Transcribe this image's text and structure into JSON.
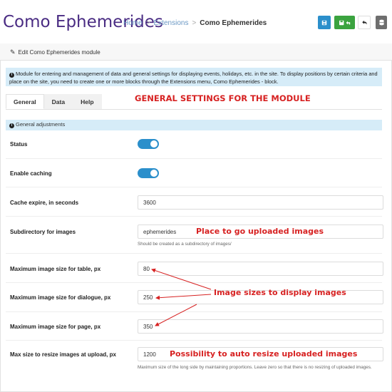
{
  "header": {
    "title": "Como Ephemerides",
    "breadcrumb": {
      "home": "Home",
      "extensions": "Extensions",
      "current": "Como Ephemerides"
    },
    "separator": ">"
  },
  "toolbar": {
    "save_icon": "save-icon",
    "save_close_icon": "save-close-icon",
    "back_icon": "undo-icon",
    "db_icon": "database-icon",
    "colors": {
      "save": "#2b8fcb",
      "save_close": "#3ba33f",
      "db": "#6e6e6e"
    }
  },
  "panel": {
    "heading": "Edit Como Ephemerides module",
    "info": "Module for entering and management of data and general settings for displaying events, holidays, etc. in the site. To display positions by certain criteria and place on the site, you need to create one or more blocks through the Extensions menu, Como Ephemerides - block.",
    "tabs": [
      "General",
      "Data",
      "Help"
    ],
    "section": "General adjustments"
  },
  "settings": {
    "status_label": "Status",
    "status_on": true,
    "caching_label": "Enable caching",
    "caching_on": true,
    "cache_expire_label": "Cache expire, in seconds",
    "cache_expire_value": "3600",
    "subdir_label": "Subdirectory for images",
    "subdir_value": "ephemerides",
    "subdir_hint": "Should be created as a subdirectory of images/",
    "max_table_label": "Maximum image size for table, px",
    "max_table_value": "80",
    "max_dialogue_label": "Maximum image size for dialogue, px",
    "max_dialogue_value": "250",
    "max_page_label": "Maximum image size for page, px",
    "max_page_value": "350",
    "resize_label": "Max size to resize images at upload, px",
    "resize_value": "1200",
    "resize_hint": "Maximum size of the long side by maintaining proportions. Leave zero so that there is no resizing of uploaded images."
  },
  "annotations": {
    "general": "GENERAL SETTINGS FOR THE MODULE",
    "place": "Place to go uploaded images",
    "sizes": "Image sizes to display images",
    "resize": "Possibility to auto resize uploaded images",
    "color": "#d72222"
  },
  "colors": {
    "accent": "#4a2c83",
    "toggle": "#2b8fcb",
    "info_bg": "#d6ecf8"
  }
}
